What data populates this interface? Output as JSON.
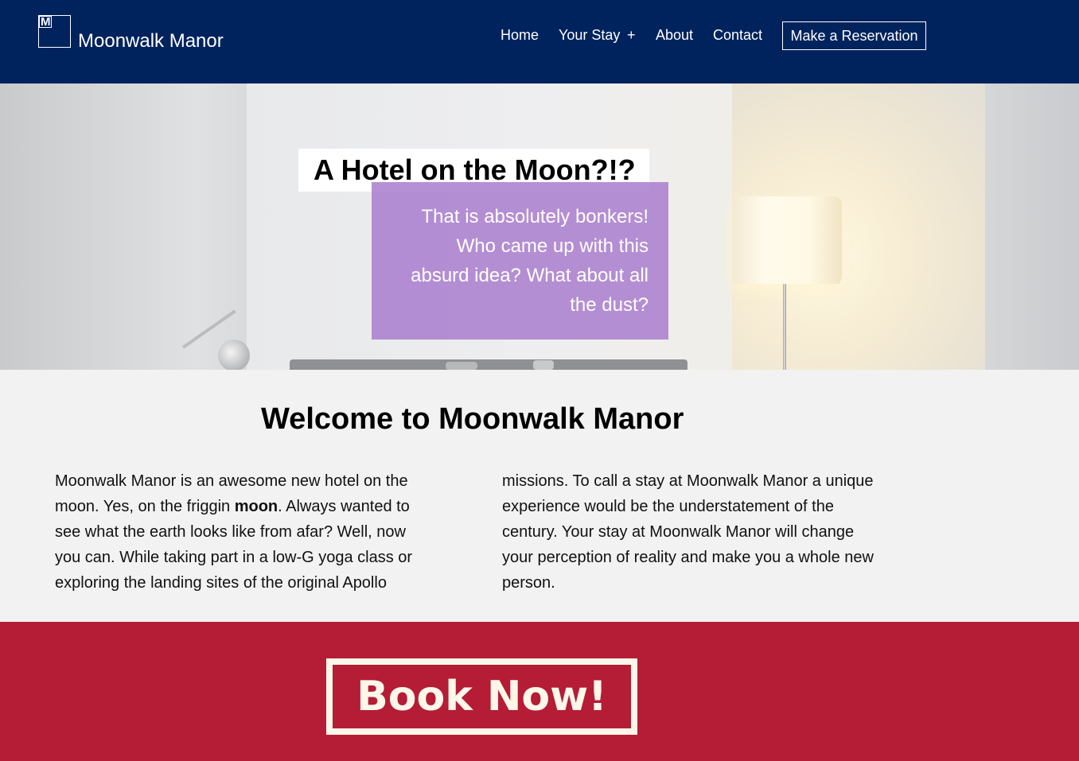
{
  "header": {
    "logo_icon": "moonwalk-manor-logo",
    "brand": "Moonwalk Manor",
    "nav": {
      "home": "Home",
      "your_stay": "Your Stay",
      "expand_symbol": "+",
      "about": "About",
      "contact": "Contact"
    },
    "cta": "Make a Reservation"
  },
  "hero": {
    "title": "A Hotel on the Moon?!?",
    "subtitle_lines": [
      "That is absolutely bonkers!",
      "Who came up with this",
      "absurd idea? What about all",
      "the dust?"
    ]
  },
  "welcome": {
    "title": "Welcome to Moonwalk Manor",
    "left_lines": {
      "l1": "Moonwalk Manor is an awesome new hotel on the",
      "l2_pre": "moon. Yes, on the friggin ",
      "l2_bold": "moon",
      "l2_post": ". Always wanted to",
      "l3": "see what the earth looks like from afar? Well, now",
      "l4": "you can. While taking part in a low-G yoga class or",
      "l5": "exploring the landing sites of the original Apollo"
    },
    "right_lines": [
      "missions. To call a stay at Moonwalk Manor a unique",
      "experience would be the understatement of the",
      "century. Your stay at Moonwalk Manor will change",
      "your perception of reality and make you a whole new",
      "person."
    ]
  },
  "book": {
    "label": "Book Now!"
  },
  "colors": {
    "header_bg": "#00235d",
    "hero_subtitle_bg": "#a97cce",
    "book_band_bg": "#b51c36",
    "book_text": "#fdf7ea"
  }
}
